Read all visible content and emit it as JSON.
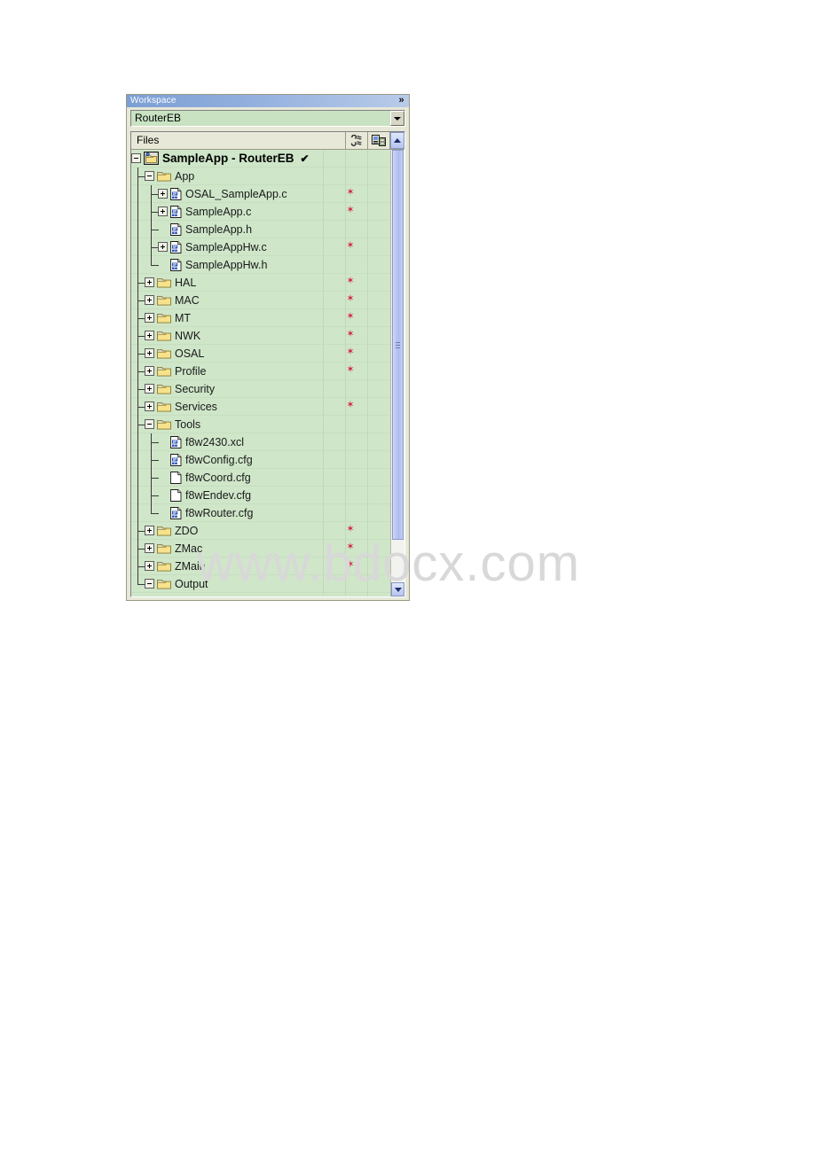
{
  "window": {
    "title": "Workspace",
    "close_glyph": "»"
  },
  "config_combo": {
    "value": "RouterEB",
    "arrow_icon": "chevron-down-icon"
  },
  "tree_header": {
    "files_label": "Files",
    "button_1_icon": "two-state-toggle-icon",
    "button_2_icon": "copy-build-icon",
    "scroll_up_icon": "chevron-up-icon"
  },
  "scrollbar": {
    "down_icon": "chevron-down-icon"
  },
  "watermark": {
    "text": "www.bdocx.com"
  },
  "colors": {
    "tree_background": "#cfe6c9",
    "titlebar_blue": "#7c9fd4",
    "header_beige": "#e8e8d8",
    "star_red": "#d4243c",
    "folder_yellow": "#f5e08a",
    "source_icon_blue": "#2a53b8"
  },
  "tree": {
    "star_glyph": "✶",
    "check_glyph": "✔",
    "rows": [
      {
        "label": "SampleApp - RouterEB",
        "icon": "workspace-icon",
        "depth": 0,
        "expander": "minus",
        "star": false,
        "check": true,
        "root": true
      },
      {
        "label": "App",
        "icon": "folder-icon",
        "depth": 1,
        "expander": "minus",
        "star": false,
        "check": false,
        "root": false
      },
      {
        "label": "OSAL_SampleApp.c",
        "icon": "source-file-icon",
        "depth": 2,
        "expander": "plus",
        "star": true,
        "check": false,
        "root": false
      },
      {
        "label": "SampleApp.c",
        "icon": "source-file-icon",
        "depth": 2,
        "expander": "plus",
        "star": true,
        "check": false,
        "root": false
      },
      {
        "label": "SampleApp.h",
        "icon": "source-file-icon",
        "depth": 2,
        "expander": "none",
        "star": false,
        "check": false,
        "root": false
      },
      {
        "label": "SampleAppHw.c",
        "icon": "source-file-icon",
        "depth": 2,
        "expander": "plus",
        "star": true,
        "check": false,
        "root": false
      },
      {
        "label": "SampleAppHw.h",
        "icon": "source-file-icon",
        "depth": 2,
        "expander": "none",
        "star": false,
        "check": false,
        "root": false
      },
      {
        "label": "HAL",
        "icon": "folder-icon",
        "depth": 1,
        "expander": "plus",
        "star": true,
        "check": false,
        "root": false
      },
      {
        "label": "MAC",
        "icon": "folder-icon",
        "depth": 1,
        "expander": "plus",
        "star": true,
        "check": false,
        "root": false
      },
      {
        "label": "MT",
        "icon": "folder-icon",
        "depth": 1,
        "expander": "plus",
        "star": true,
        "check": false,
        "root": false
      },
      {
        "label": "NWK",
        "icon": "folder-icon",
        "depth": 1,
        "expander": "plus",
        "star": true,
        "check": false,
        "root": false
      },
      {
        "label": "OSAL",
        "icon": "folder-icon",
        "depth": 1,
        "expander": "plus",
        "star": true,
        "check": false,
        "root": false
      },
      {
        "label": "Profile",
        "icon": "folder-icon",
        "depth": 1,
        "expander": "plus",
        "star": true,
        "check": false,
        "root": false
      },
      {
        "label": "Security",
        "icon": "folder-icon",
        "depth": 1,
        "expander": "plus",
        "star": false,
        "check": false,
        "root": false
      },
      {
        "label": "Services",
        "icon": "folder-icon",
        "depth": 1,
        "expander": "plus",
        "star": true,
        "check": false,
        "root": false
      },
      {
        "label": "Tools",
        "icon": "folder-icon",
        "depth": 1,
        "expander": "minus",
        "star": false,
        "check": false,
        "root": false
      },
      {
        "label": "f8w2430.xcl",
        "icon": "source-file-icon",
        "depth": 2,
        "expander": "none",
        "star": false,
        "check": false,
        "root": false
      },
      {
        "label": "f8wConfig.cfg",
        "icon": "source-file-icon",
        "depth": 2,
        "expander": "none",
        "star": false,
        "check": false,
        "root": false
      },
      {
        "label": "f8wCoord.cfg",
        "icon": "blank-file-icon",
        "depth": 2,
        "expander": "none",
        "star": false,
        "check": false,
        "root": false
      },
      {
        "label": "f8wEndev.cfg",
        "icon": "blank-file-icon",
        "depth": 2,
        "expander": "none",
        "star": false,
        "check": false,
        "root": false
      },
      {
        "label": "f8wRouter.cfg",
        "icon": "source-file-icon",
        "depth": 2,
        "expander": "none",
        "star": false,
        "check": false,
        "root": false,
        "last": true
      },
      {
        "label": "ZDO",
        "icon": "folder-icon",
        "depth": 1,
        "expander": "plus",
        "star": true,
        "check": false,
        "root": false
      },
      {
        "label": "ZMac",
        "icon": "folder-icon",
        "depth": 1,
        "expander": "plus",
        "star": true,
        "check": false,
        "root": false
      },
      {
        "label": "ZMain",
        "icon": "folder-icon",
        "depth": 1,
        "expander": "plus",
        "star": true,
        "check": false,
        "root": false
      },
      {
        "label": "Output",
        "icon": "folder-icon",
        "depth": 1,
        "expander": "minus",
        "star": false,
        "check": false,
        "root": false,
        "last": true
      }
    ]
  }
}
